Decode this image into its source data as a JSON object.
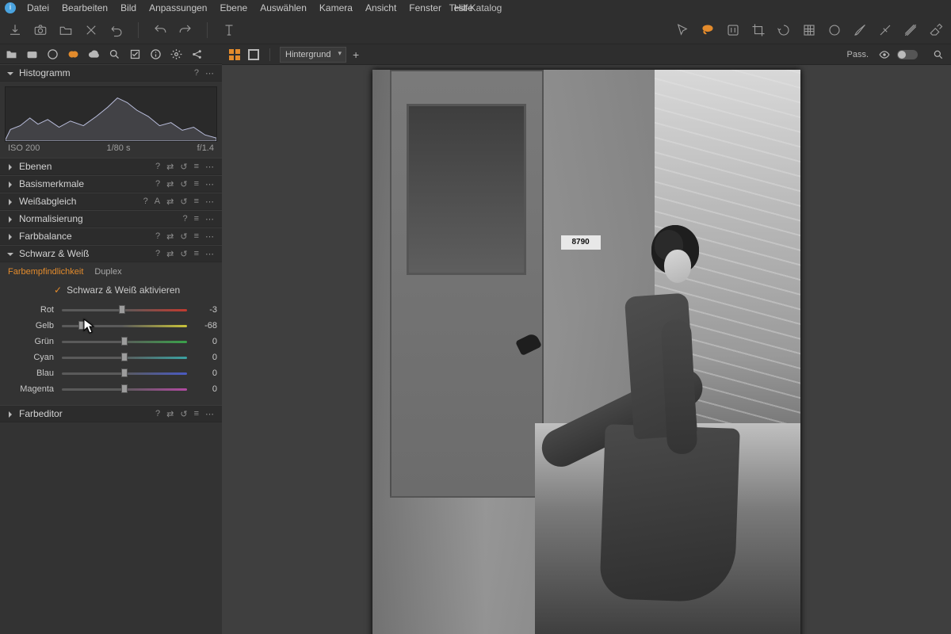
{
  "app": {
    "title": "Test-Katalog"
  },
  "menu": {
    "file": "Datei",
    "edit": "Bearbeiten",
    "image": "Bild",
    "adjust": "Anpassungen",
    "layer": "Ebene",
    "select": "Auswählen",
    "camera": "Kamera",
    "view": "Ansicht",
    "window": "Fenster",
    "help": "Hilfe"
  },
  "canvas": {
    "layer_select": "Hintergrund",
    "pass_label": "Pass."
  },
  "histogram": {
    "title": "Histogramm",
    "iso": "ISO 200",
    "shutter": "1/80 s",
    "aperture": "f/1.4"
  },
  "panels": {
    "ebenen": "Ebenen",
    "basis": "Basismerkmale",
    "wb": "Weißabgleich",
    "norm": "Normalisierung",
    "farbbal": "Farbbalance",
    "bw": "Schwarz & Weiß",
    "farbeditor": "Farbeditor"
  },
  "bw": {
    "tab_sensitivity": "Farbempfindlichkeit",
    "tab_duplex": "Duplex",
    "activate": "Schwarz & Weiß aktivieren",
    "sliders": {
      "rot": {
        "label": "Rot",
        "value": -3,
        "pos": 48,
        "grad": [
          "#5a5a5a",
          "#c23a2f"
        ]
      },
      "gelb": {
        "label": "Gelb",
        "value": -68,
        "pos": 16,
        "grad": [
          "#5a5a5a",
          "#c9c33a"
        ]
      },
      "gruen": {
        "label": "Grün",
        "value": 0,
        "pos": 50,
        "grad": [
          "#5a5a5a",
          "#3aa24a"
        ]
      },
      "cyan": {
        "label": "Cyan",
        "value": 0,
        "pos": 50,
        "grad": [
          "#5a5a5a",
          "#3aa2a2"
        ]
      },
      "blau": {
        "label": "Blau",
        "value": 0,
        "pos": 50,
        "grad": [
          "#5a5a5a",
          "#4a5ac2"
        ]
      },
      "magenta": {
        "label": "Magenta",
        "value": 0,
        "pos": 50,
        "grad": [
          "#5a5a5a",
          "#b24aa2"
        ]
      }
    }
  },
  "photo": {
    "sign": "8790"
  }
}
